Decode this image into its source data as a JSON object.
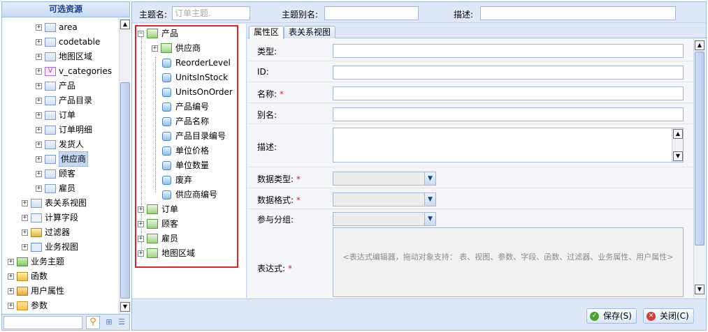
{
  "left_panel": {
    "title": "可选资源",
    "tree": [
      {
        "label": "area",
        "icon": "table-icon"
      },
      {
        "label": "codetable",
        "icon": "table-icon"
      },
      {
        "label": "地图区域",
        "icon": "table-icon"
      },
      {
        "label": "v_categories",
        "icon": "view-icon"
      },
      {
        "label": "产品",
        "icon": "table-icon"
      },
      {
        "label": "产品目录",
        "icon": "table-icon"
      },
      {
        "label": "订单",
        "icon": "table-icon"
      },
      {
        "label": "订单明细",
        "icon": "table-icon"
      },
      {
        "label": "发货人",
        "icon": "table-icon"
      },
      {
        "label": "供应商",
        "icon": "table-icon",
        "selected": true
      },
      {
        "label": "顾客",
        "icon": "table-icon"
      },
      {
        "label": "雇员",
        "icon": "table-icon"
      },
      {
        "label": "表关系视图",
        "icon": "relation-view-icon"
      },
      {
        "label": "计算字段",
        "icon": "calc-field-icon"
      },
      {
        "label": "过滤器",
        "icon": "filter-icon"
      },
      {
        "label": "业务视图",
        "icon": "business-view-icon"
      },
      {
        "label": "业务主题",
        "icon": "business-theme-icon"
      },
      {
        "label": "函数",
        "icon": "function-icon"
      },
      {
        "label": "用户属性",
        "icon": "user-attr-icon"
      },
      {
        "label": "参数",
        "icon": "param-icon"
      }
    ]
  },
  "topbar": {
    "theme_name_label": "主题名:",
    "theme_name_placeholder": "订单主题.",
    "theme_alias_label": "主题别名:",
    "desc_label": "描述:"
  },
  "theme_tree": [
    {
      "label": "产品",
      "kind": "group"
    },
    {
      "label": "供应商",
      "kind": "group"
    },
    {
      "label": "ReorderLevel",
      "kind": "field"
    },
    {
      "label": "UnitsInStock",
      "kind": "field"
    },
    {
      "label": "UnitsOnOrder",
      "kind": "field"
    },
    {
      "label": "产品编号",
      "kind": "field"
    },
    {
      "label": "产品名称",
      "kind": "field"
    },
    {
      "label": "产品目录编号",
      "kind": "field"
    },
    {
      "label": "单位价格",
      "kind": "field"
    },
    {
      "label": "单位数量",
      "kind": "field"
    },
    {
      "label": "废弃",
      "kind": "field"
    },
    {
      "label": "供应商编号",
      "kind": "field"
    },
    {
      "label": "订单",
      "kind": "group"
    },
    {
      "label": "顾客",
      "kind": "group"
    },
    {
      "label": "雇员",
      "kind": "group"
    },
    {
      "label": "地图区域",
      "kind": "group"
    }
  ],
  "tabs": [
    {
      "label": "属性区",
      "active": true
    },
    {
      "label": "表关系视图",
      "active": false
    }
  ],
  "form": {
    "type_label": "类型:",
    "id_label": "ID:",
    "name_label": "名称:",
    "alias_label": "别名:",
    "desc_label": "描述:",
    "data_type_label": "数据类型:",
    "data_format_label": "数据格式:",
    "group_label": "参与分组:",
    "expr_label": "表达式:",
    "required_mark": "*",
    "expr_placeholder": "<表达式编辑器，拖动对象支持：  表、视图、参数、字段、函数、过滤器、业务属性、用户属性>"
  },
  "footer": {
    "save_label": "保存(S)",
    "close_label": "关闭(C)"
  },
  "colors": {
    "panel_border": "#99bbe8",
    "panel_bg": "#dfe8f6",
    "highlight_box": "#e02424",
    "required": "#e02424"
  }
}
